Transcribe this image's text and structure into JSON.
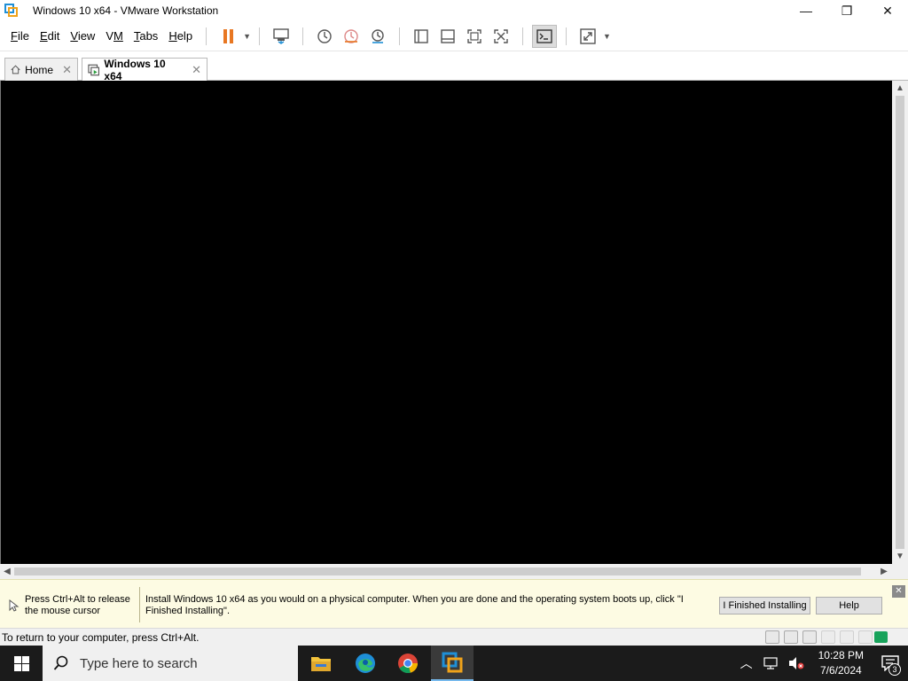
{
  "window": {
    "title": "Windows 10 x64 - VMware Workstation",
    "controls": {
      "minimize": "—",
      "restore": "❐",
      "close": "✕"
    }
  },
  "menu": {
    "items": [
      {
        "label": "File",
        "accel": "F"
      },
      {
        "label": "Edit",
        "accel": "E"
      },
      {
        "label": "View",
        "accel": "V"
      },
      {
        "label": "VM",
        "accel": "M"
      },
      {
        "label": "Tabs",
        "accel": "T"
      },
      {
        "label": "Help",
        "accel": "H"
      }
    ]
  },
  "toolbar": {
    "buttons": [
      "pause-icon",
      "send-ctrl-alt-del-icon",
      "snapshot-take-icon",
      "snapshot-revert-icon",
      "snapshot-manager-icon",
      "show-library-icon",
      "show-thumbnail-bar-icon",
      "full-screen-icon",
      "unity-icon",
      "console-view-icon",
      "stretch-guest-icon"
    ]
  },
  "tabs": [
    {
      "label": "Home",
      "icon": "home-icon",
      "active": false
    },
    {
      "label": "Windows 10 x64",
      "icon": "vm-icon",
      "active": true
    }
  ],
  "hint_bar": {
    "release_text": "Press Ctrl+Alt to release the mouse cursor",
    "message": "Install Windows 10 x64 as you would on a physical computer. When you are done and the operating system boots up, click \"I Finished Installing\".",
    "finished_button": "I Finished Installing",
    "help_button": "Help"
  },
  "status_bar": {
    "text": "To return to your computer, press Ctrl+Alt.",
    "device_icons": [
      "hard-disk-icon",
      "cd-dvd-icon",
      "network-adapter-icon",
      "usb-icon",
      "sound-icon",
      "printer-icon"
    ]
  },
  "taskbar": {
    "search_placeholder": "Type here to search",
    "apps": [
      "file-explorer-icon",
      "edge-icon",
      "chrome-icon",
      "vmware-icon"
    ],
    "clock_time": "10:28 PM",
    "clock_date": "7/6/2024",
    "notification_count": "3"
  },
  "colors": {
    "pause_orange": "#e87722",
    "hint_background": "#fdfbe3",
    "taskbar": "#1b1b1b",
    "vm_screen": "#000000"
  }
}
